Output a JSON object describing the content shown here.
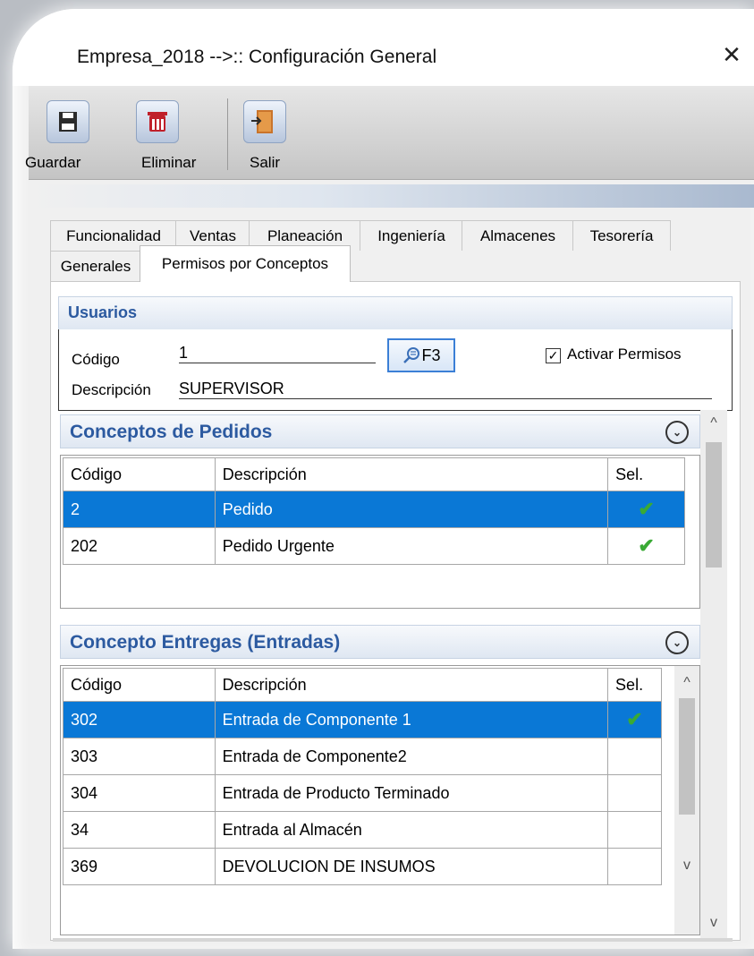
{
  "window": {
    "title": "Empresa_2018 -->:: Configuración General",
    "close_symbol": "✕"
  },
  "toolbar": {
    "buttons": [
      {
        "label": "Guardar",
        "icon": "save-icon"
      },
      {
        "label": "Eliminar",
        "icon": "trash-icon"
      },
      {
        "label": "Salir",
        "icon": "exit-door-icon"
      }
    ]
  },
  "tabs": {
    "row1": [
      "Funcionalidad",
      "Ventas",
      "Planeación",
      "Ingeniería",
      "Almacenes",
      "Tesorería"
    ],
    "row2": [
      "Generales",
      "Permisos por Conceptos"
    ],
    "active": "Permisos por Conceptos"
  },
  "usuarios": {
    "header": "Usuarios",
    "codigo_label": "Código",
    "codigo_value": "1",
    "lookup_button": "F3",
    "descripcion_label": "Descripción",
    "descripcion_value": "SUPERVISOR",
    "activar_label": "Activar Permisos",
    "activar_checked": true,
    "check_symbol": "✓"
  },
  "pedidos": {
    "header": "Conceptos de Pedidos",
    "columns": [
      "Código",
      "Descripción",
      "Sel."
    ],
    "rows": [
      {
        "codigo": "2",
        "descripcion": "Pedido",
        "sel": "✔",
        "selected": true
      },
      {
        "codigo": "202",
        "descripcion": "Pedido Urgente",
        "sel": "✔",
        "selected": false
      }
    ]
  },
  "entregas": {
    "header": "Concepto Entregas (Entradas)",
    "columns": [
      "Código",
      "Descripción",
      "Sel."
    ],
    "rows": [
      {
        "codigo": "302",
        "descripcion": "Entrada de Componente 1",
        "sel": "✔",
        "selected": true
      },
      {
        "codigo": "303",
        "descripcion": "Entrada de Componente2",
        "sel": "",
        "selected": false
      },
      {
        "codigo": "304",
        "descripcion": "Entrada de Producto Terminado",
        "sel": "",
        "selected": false
      },
      {
        "codigo": "34",
        "descripcion": "Entrada al Almacén",
        "sel": "",
        "selected": false
      },
      {
        "codigo": "369",
        "descripcion": "DEVOLUCION DE INSUMOS",
        "sel": "",
        "selected": false
      }
    ]
  },
  "scroll": {
    "up": "^",
    "down": "v"
  },
  "chevron": "⌄"
}
